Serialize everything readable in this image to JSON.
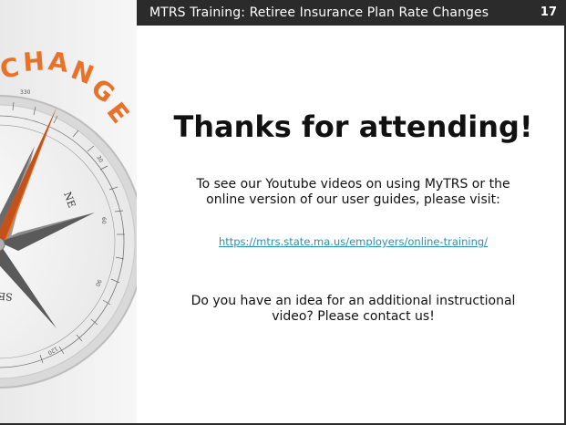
{
  "header": {
    "title": "MTRS Training: Retiree Insurance Plan Rate Changes",
    "slide_number": "17"
  },
  "art": {
    "word": "CHANGE",
    "direction_ne": "NE",
    "direction_se": "SE",
    "degree_labels": [
      "330",
      "30",
      "60",
      "90",
      "120"
    ],
    "accent_color": "#e8722a"
  },
  "main": {
    "heading": "Thanks for attending!",
    "paragraph1_line1": "To see our Youtube videos on using MyTRS or the",
    "paragraph1_line2": "online version of our user guides, please visit:",
    "link": "https://mtrs.state.ma.us/employers/online-training/",
    "paragraph2_line1": "Do you have an idea for an additional instructional",
    "paragraph2_line2": "video?  Please contact us!"
  },
  "colors": {
    "header_bg": "#2b2b2b",
    "link": "#2a8fb8",
    "change_text": "#e8722a"
  }
}
